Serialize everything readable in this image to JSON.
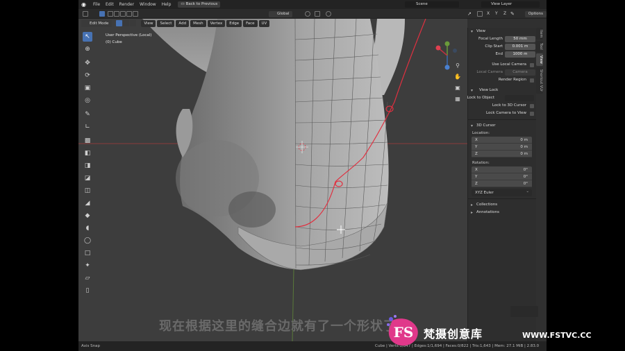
{
  "menu": [
    "File",
    "Edit",
    "Render",
    "Window",
    "Help"
  ],
  "back_to_previous": "Back to Previous",
  "scene": "Scene",
  "view_layer": "View Layer",
  "header": {
    "orientation": "Global",
    "options": "Options",
    "mode": "Edit Mode",
    "view_menus": [
      "View",
      "Select",
      "Add",
      "Mesh",
      "Vertex",
      "Edge",
      "Face",
      "UV"
    ]
  },
  "viewport": {
    "perspective": "User Perspective (Local)",
    "object": "(0) Cube"
  },
  "side_tabs": [
    "Item",
    "Tool",
    "View",
    "Shortcut VUr"
  ],
  "view_panel": {
    "title": "View",
    "focal_length_label": "Focal Length",
    "focal_length": "50 mm",
    "clip_start_label": "Clip Start",
    "clip_start": "0.001 m",
    "end_label": "End",
    "end": "1000 m",
    "use_local_camera": "Use Local Camera",
    "local_camera_label": "Local Camera",
    "local_camera": "Camera",
    "render_region": "Render Region",
    "view_lock_title": "View Lock",
    "lock_to_object": "Lock to Object",
    "lock_to_3d_cursor": "Lock to 3D Cursor",
    "lock_camera_to_view": "Lock Camera to View"
  },
  "cursor_panel": {
    "title": "3D Cursor",
    "location_label": "Location:",
    "location": [
      {
        "axis": "X",
        "value": "0 m"
      },
      {
        "axis": "Y",
        "value": "0 m"
      },
      {
        "axis": "Z",
        "value": "0 m"
      }
    ],
    "rotation_label": "Rotation:",
    "rotation": [
      {
        "axis": "X",
        "value": "0°"
      },
      {
        "axis": "Y",
        "value": "0°"
      },
      {
        "axis": "Z",
        "value": "0°"
      }
    ],
    "rotation_mode": "XYZ Euler"
  },
  "collections": "Collections",
  "annotations": "Annotations",
  "status": {
    "left": "Axis Snap",
    "right": "Cube | Verts:1/847 | Edges:1/1,694 | Faces:0/822 | Tris:1,643 | Mem: 27.1 MiB | 2.83.0"
  },
  "subtitle": "现在根据这里的缝合边就有了一个形状了",
  "watermark": {
    "logo_text": "FS",
    "name": "梵摄创意库",
    "url": "WWW.FSTVC.CC"
  },
  "colors": {
    "accent": "#4772b3",
    "seam": "#e03040",
    "watermark_pink": "#e0388a"
  }
}
